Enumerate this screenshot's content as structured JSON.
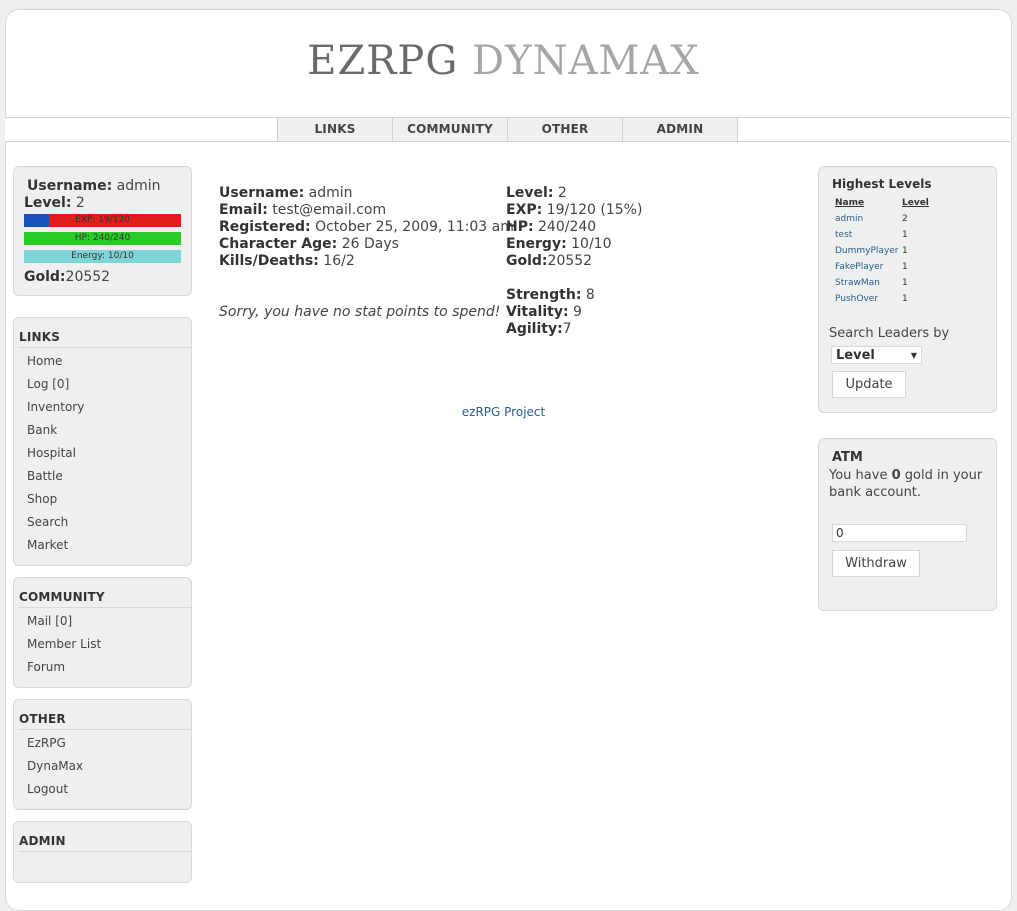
{
  "header": {
    "logo_part1": "EZRPG",
    "logo_part2": "DYNAMAX"
  },
  "nav": {
    "tabs": [
      "LINKS",
      "COMMUNITY",
      "OTHER",
      "ADMIN"
    ]
  },
  "player_box": {
    "username_label": "Username:",
    "username": "admin",
    "level_label": "Level:",
    "level": "2",
    "exp_bar_text": "EXP: 19/120",
    "exp_fraction": 0.158,
    "hp_bar_text": "HP: 240/240",
    "energy_bar_text": "Energy: 10/10",
    "gold_label": "Gold:",
    "gold": "20552"
  },
  "menus": {
    "links": {
      "title": "LINKS",
      "items": [
        "Home",
        "Log [0]",
        "Inventory",
        "Bank",
        "Hospital",
        "Battle",
        "Shop",
        "Search",
        "Market"
      ]
    },
    "community": {
      "title": "COMMUNITY",
      "items": [
        "Mail [0]",
        "Member List",
        "Forum"
      ]
    },
    "other": {
      "title": "OTHER",
      "items": [
        "EzRPG",
        "DynaMax",
        "Logout"
      ]
    },
    "admin": {
      "title": "ADMIN"
    }
  },
  "main": {
    "left": [
      {
        "label": "Username:",
        "value": " admin"
      },
      {
        "label": "Email:",
        "value": " test@email.com"
      },
      {
        "label": "Registered:",
        "value": " October 25, 2009, 11:03 am"
      },
      {
        "label": "Character Age:",
        "value": " 26 Days"
      },
      {
        "label": "Kills/Deaths:",
        "value": " 16/2"
      }
    ],
    "right": [
      {
        "label": "Level:",
        "value": " 2"
      },
      {
        "label": "EXP:",
        "value": " 19/120 (15%)"
      },
      {
        "label": "HP:",
        "value": " 240/240"
      },
      {
        "label": "Energy:",
        "value": " 10/10"
      },
      {
        "label": "Gold:",
        "value": "20552"
      }
    ],
    "attrs": [
      {
        "label": "Strength:",
        "value": " 8"
      },
      {
        "label": "Vitality:",
        "value": " 9"
      },
      {
        "label": "Agility:",
        "value": "7"
      }
    ],
    "no_points_msg": "Sorry, you have no stat points to spend!",
    "footer_link": "ezRPG Project"
  },
  "highest_levels": {
    "title": "Highest Levels",
    "col_name": "Name",
    "col_level": "Level",
    "rows": [
      {
        "name": "admin",
        "level": "2"
      },
      {
        "name": "test",
        "level": "1"
      },
      {
        "name": "DummyPlayer",
        "level": "1"
      },
      {
        "name": "FakePlayer",
        "level": "1"
      },
      {
        "name": "StrawMan",
        "level": "1"
      },
      {
        "name": "PushOver",
        "level": "1"
      }
    ],
    "search_label": "Search Leaders by",
    "select_value": "Level",
    "update_button": "Update"
  },
  "atm": {
    "title": "ATM",
    "text_before": "You have ",
    "gold": "0",
    "text_after": " gold in your bank account.",
    "amount_value": "0",
    "withdraw_button": "Withdraw"
  },
  "colors": {
    "exp_fill": "#1c4fc0",
    "exp_bar": "#e01c1c",
    "hp_bar": "#27cc27",
    "energy_bar": "#7fd4d8",
    "link": "#2a5d8f"
  }
}
